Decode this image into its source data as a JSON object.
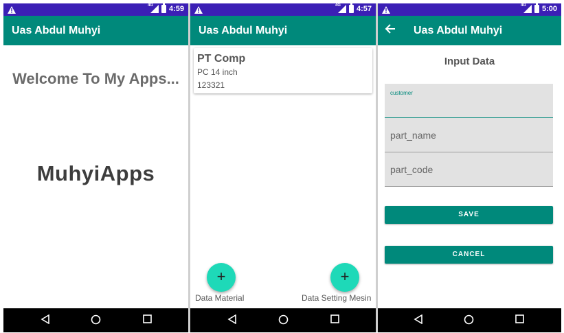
{
  "screens": [
    {
      "status": {
        "time": "4:59",
        "network": "4G"
      },
      "app_title": "Uas Abdul Muhyi",
      "welcome_text": "Welcome To My Apps...",
      "brand_text": "MuhyiApps"
    },
    {
      "status": {
        "time": "4:57",
        "network": "4G"
      },
      "app_title": "Uas Abdul Muhyi",
      "card": {
        "title": "PT Comp",
        "subtitle": "PC 14 inch",
        "code": "123321"
      },
      "fab_left": {
        "icon": "+",
        "label": "Data Material"
      },
      "fab_right": {
        "icon": "+",
        "label": "Data Setting Mesin"
      }
    },
    {
      "status": {
        "time": "5:00",
        "network": "4G"
      },
      "app_title": "Uas Abdul Muhyi",
      "back_icon": "arrow-back-icon",
      "heading": "Input Data",
      "fields": [
        {
          "label": "customer",
          "placeholder": ""
        },
        {
          "label": "",
          "placeholder": "part_name"
        },
        {
          "label": "",
          "placeholder": "part_code"
        }
      ],
      "save_label": "SAVE",
      "cancel_label": "CANCEL"
    }
  ],
  "colors": {
    "status_bar": "#3b1fb5",
    "app_bar": "#00897b",
    "fab": "#1ed9b8",
    "nav_bar": "#000000"
  },
  "nav_icons": [
    "back-triangle-icon",
    "home-circle-icon",
    "recents-square-icon"
  ]
}
